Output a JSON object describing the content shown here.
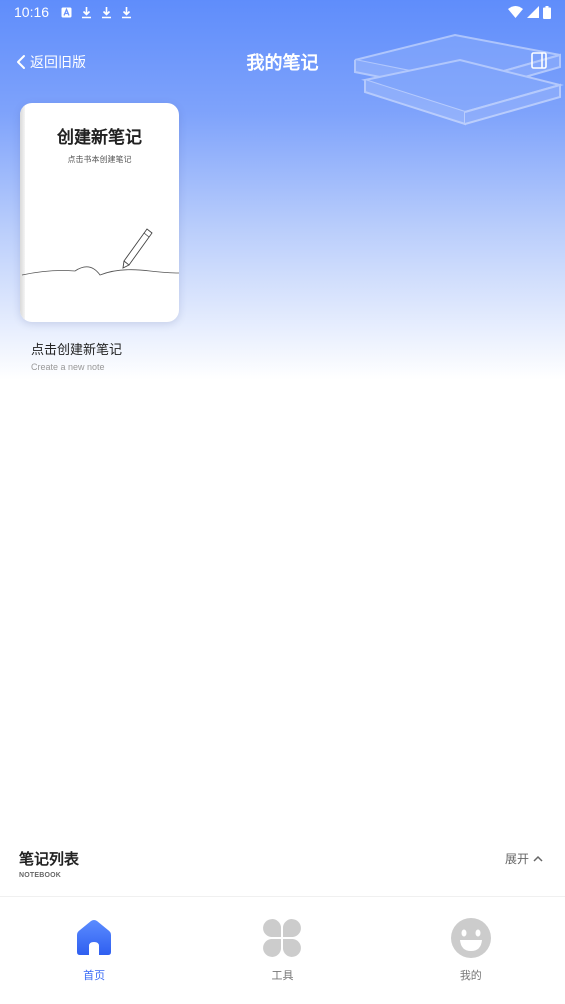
{
  "status_bar": {
    "time": "10:16"
  },
  "header": {
    "back_label": "返回旧版",
    "title": "我的笔记"
  },
  "new_note": {
    "card_title": "创建新笔记",
    "card_subtitle": "点击书本创建笔记",
    "caption": "点击创建新笔记",
    "caption_en": "Create a new note"
  },
  "notebook_list": {
    "title": "笔记列表",
    "title_en": "NOTEBOOK",
    "expand_label": "展开"
  },
  "bottom_nav": {
    "items": [
      {
        "label": "首页",
        "icon": "home-icon",
        "active": true
      },
      {
        "label": "工具",
        "icon": "tools-icon",
        "active": false
      },
      {
        "label": "我的",
        "icon": "profile-icon",
        "active": false
      }
    ]
  },
  "colors": {
    "accent": "#3b6cf5",
    "header_gradient_top": "#5f8dfb",
    "inactive_icon": "#cccccc"
  }
}
